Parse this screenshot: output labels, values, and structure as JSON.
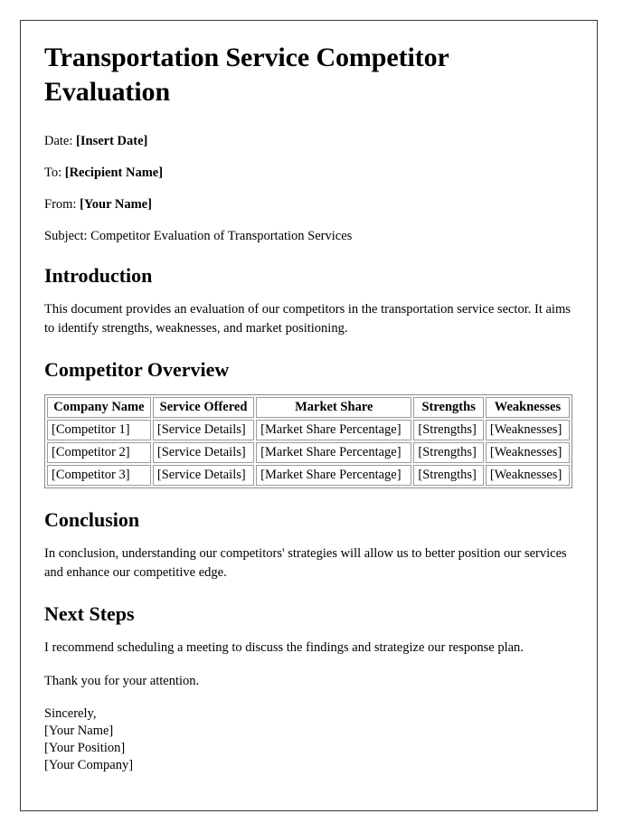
{
  "document": {
    "title": "Transportation Service Competitor Evaluation",
    "meta": [
      {
        "label": "Date:",
        "value": "[Insert Date]"
      },
      {
        "label": "To:",
        "value": "[Recipient Name]"
      },
      {
        "label": "From:",
        "value": "[Your Name]"
      }
    ],
    "subject_line": "Subject: Competitor Evaluation of Transportation Services",
    "sections": {
      "introduction": {
        "heading": "Introduction",
        "paragraph": "This document provides an evaluation of our competitors in the transportation service sector. It aims to identify strengths, weaknesses, and market positioning."
      },
      "competitor_overview": {
        "heading": "Competitor Overview"
      },
      "conclusion": {
        "heading": "Conclusion",
        "paragraph": "In conclusion, understanding our competitors' strategies will allow us to better position our services and enhance our competitive edge."
      },
      "next_steps": {
        "heading": "Next Steps",
        "paragraph": "I recommend scheduling a meeting to discuss the findings and strategize our response plan.",
        "thanks": "Thank you for your attention."
      }
    },
    "table": {
      "headers": [
        "Company Name",
        "Service Offered",
        "Market Share",
        "Strengths",
        "Weaknesses"
      ],
      "rows": [
        [
          "[Competitor 1]",
          "[Service Details]",
          "[Market Share Percentage]",
          "[Strengths]",
          "[Weaknesses]"
        ],
        [
          "[Competitor 2]",
          "[Service Details]",
          "[Market Share Percentage]",
          "[Strengths]",
          "[Weaknesses]"
        ],
        [
          "[Competitor 3]",
          "[Service Details]",
          "[Market Share Percentage]",
          "[Strengths]",
          "[Weaknesses]"
        ]
      ]
    },
    "signature": {
      "closing": "Sincerely,",
      "name": "[Your Name]",
      "position": "[Your Position]",
      "company": "[Your Company]"
    }
  },
  "colors": {
    "page_background": "#ffffff",
    "text": "#000000",
    "frame_border": "#3a3a3a",
    "table_border": "#9a9a9a"
  }
}
